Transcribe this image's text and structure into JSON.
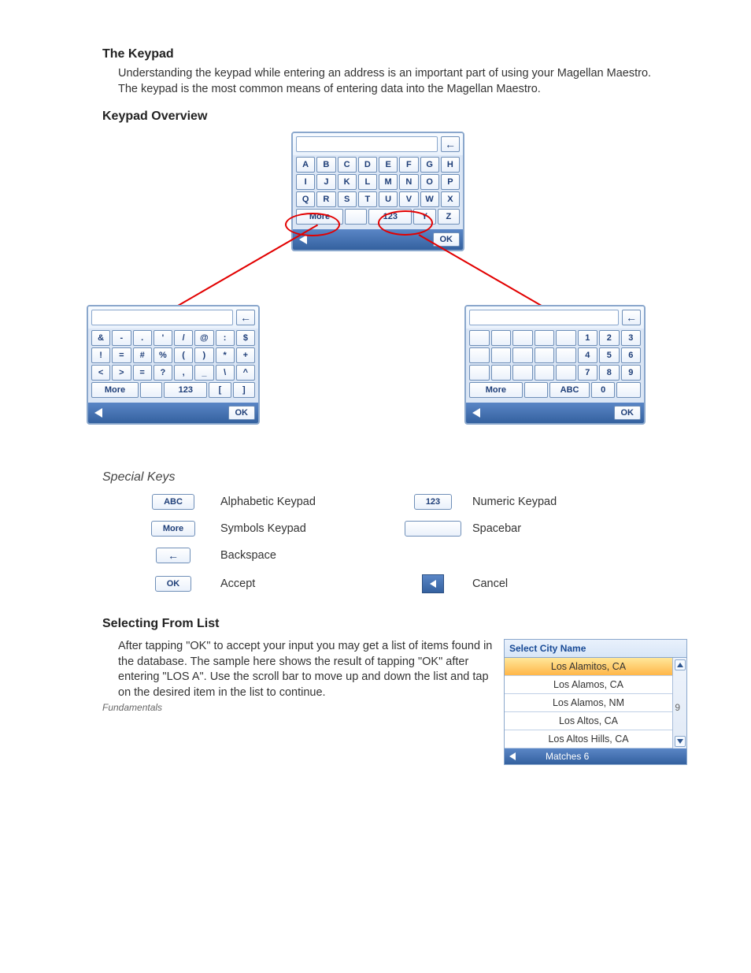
{
  "headings": {
    "keypad": "The Keypad",
    "overview": "Keypad Overview",
    "special": "Special Keys",
    "selecting": "Selecting From List"
  },
  "para1": "Understanding the keypad while entering an address is an important part of using your Magellan Maestro.  The keypad is the most common means of entering data into the Magellan Maestro.",
  "para2": "After tapping \"OK\" to accept your input you may get a list of items found in the database.  The sample here shows the result of tapping \"OK\" after entering \"LOS A\".  Use the scroll bar to move up and down the list and tap on the desired item in the list to continue.",
  "keypad_alpha": {
    "rows": [
      [
        "A",
        "B",
        "C",
        "D",
        "E",
        "F",
        "G",
        "H"
      ],
      [
        "I",
        "J",
        "K",
        "L",
        "M",
        "N",
        "O",
        "P"
      ],
      [
        "Q",
        "R",
        "S",
        "T",
        "U",
        "V",
        "W",
        "X"
      ]
    ],
    "more": "More",
    "num": "123",
    "y": "Y",
    "z": "Z",
    "ok": "OK"
  },
  "keypad_sym": {
    "rows": [
      [
        "&",
        "-",
        ".",
        "'",
        "/",
        "@",
        ":",
        "$"
      ],
      [
        "!",
        "=",
        "#",
        "%",
        "(",
        ")",
        "*",
        "+"
      ],
      [
        "<",
        ">",
        "=",
        "?",
        ",",
        "_",
        "\\",
        "^"
      ]
    ],
    "more": "More",
    "num": "123",
    "lb": "[",
    "rb": "]",
    "ok": "OK"
  },
  "keypad_num": {
    "rows": [
      [
        "",
        "",
        "",
        "",
        "",
        "1",
        "2",
        "3"
      ],
      [
        "",
        "",
        "",
        "",
        "",
        "4",
        "5",
        "6"
      ],
      [
        "",
        "",
        "",
        "",
        "",
        "7",
        "8",
        "9"
      ]
    ],
    "more": "More",
    "abc": "ABC",
    "zero": "0",
    "ok": "OK"
  },
  "special": {
    "abc": "ABC",
    "abc_label": "Alphabetic Keypad",
    "num": "123",
    "num_label": "Numeric Keypad",
    "more": "More",
    "more_label": "Symbols Keypad",
    "space_label": "Spacebar",
    "back_label": "Backspace",
    "ok": "OK",
    "ok_label": "Accept",
    "cancel_label": "Cancel"
  },
  "list": {
    "header": "Select City Name",
    "items": [
      "Los Alamitos, CA",
      "Los Alamos, CA",
      "Los Alamos, NM",
      "Los Altos, CA",
      "Los Altos Hills, CA"
    ],
    "footer": "Matches  6"
  },
  "footer": {
    "section": "Fundamentals",
    "page": "9"
  }
}
